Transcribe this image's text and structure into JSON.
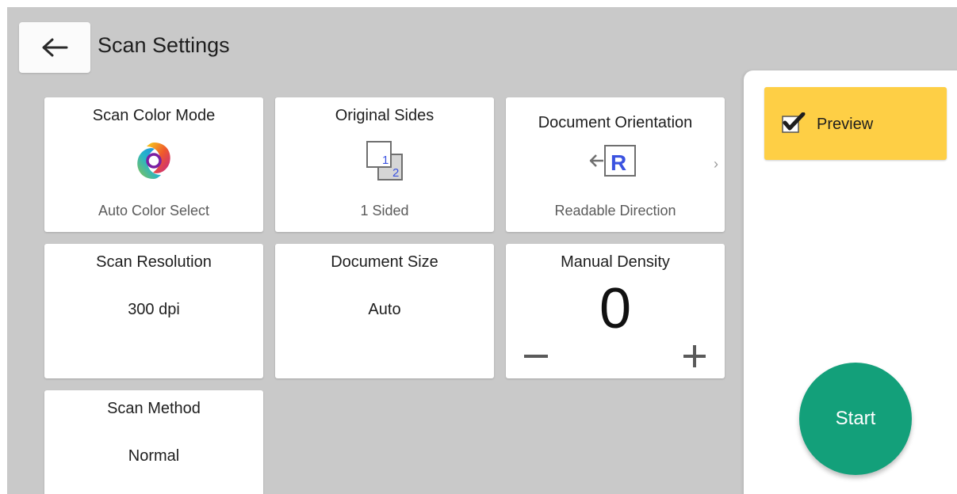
{
  "header": {
    "title": "Scan Settings",
    "back_icon": "arrow-left-icon"
  },
  "tiles": {
    "color_mode": {
      "title": "Scan Color Mode",
      "value": "Auto Color Select",
      "icon": "color-wheel-icon"
    },
    "original_sides": {
      "title": "Original Sides",
      "value": "1 Sided",
      "icon": "one-sided-icon",
      "icon_digit_front": "1",
      "icon_digit_back": "2"
    },
    "orientation": {
      "title": "Document Orientation",
      "value": "Readable Direction",
      "icon": "readable-direction-icon",
      "icon_letter": "R",
      "more_icon": "chevron-right-icon"
    },
    "resolution": {
      "title": "Scan Resolution",
      "value": "300 dpi"
    },
    "doc_size": {
      "title": "Document Size",
      "value": "Auto"
    },
    "density": {
      "title": "Manual Density",
      "value": "0",
      "minus_icon": "minus-icon",
      "plus_icon": "plus-icon"
    },
    "scan_method": {
      "title": "Scan Method",
      "value": "Normal"
    }
  },
  "side_panel": {
    "preview_label": "Preview",
    "preview_checked": true,
    "start_label": "Start"
  },
  "colors": {
    "background": "#c9c9c9",
    "preview_yellow": "#fecf45",
    "start_green": "#13a07a",
    "icon_blue": "#3a52e0"
  }
}
